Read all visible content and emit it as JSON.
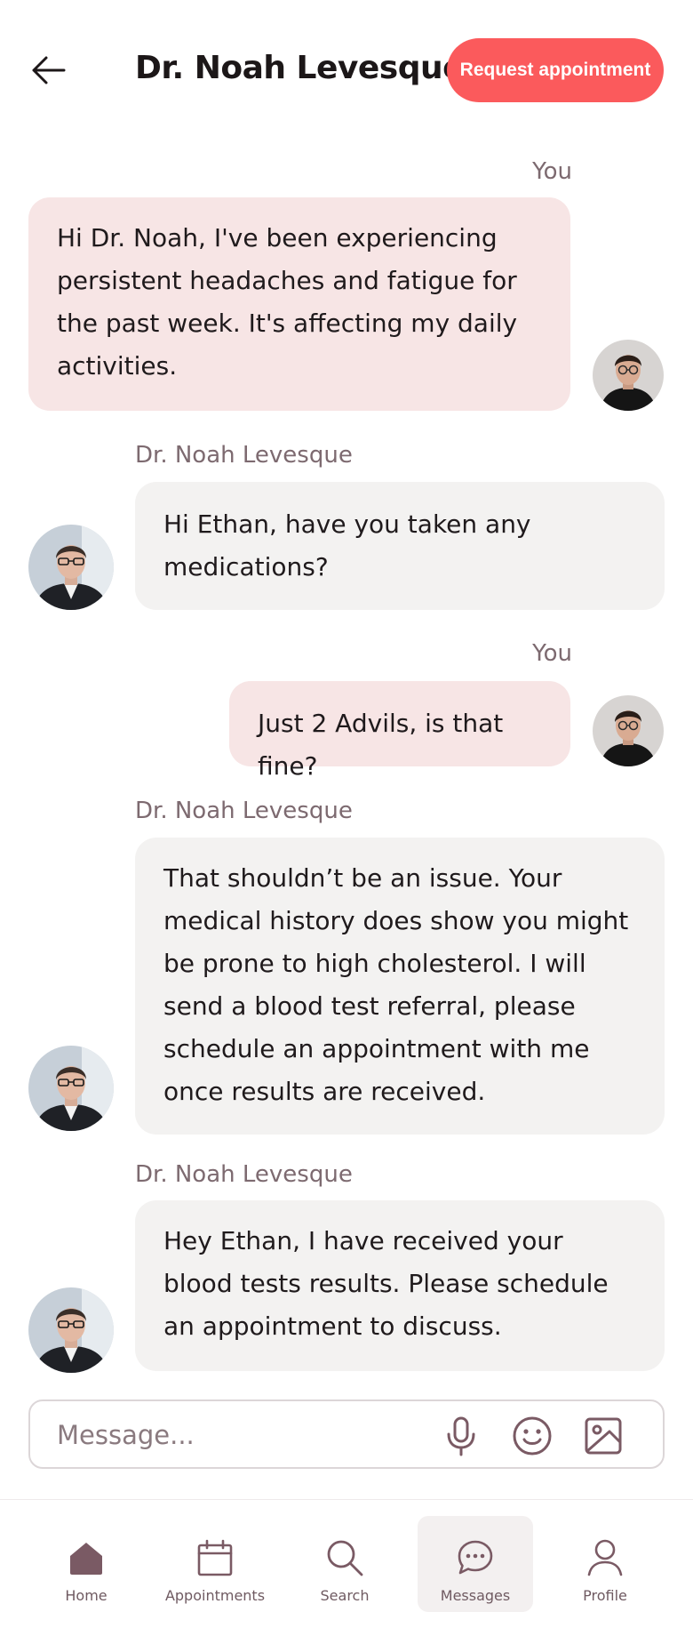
{
  "header": {
    "title": "Dr. Noah Levesque",
    "request_button": "Request appointment"
  },
  "messages": [
    {
      "sender": "You",
      "text": "Hi Dr. Noah, I've been experiencing persistent headaches and fatigue for the past week. It's affecting my daily activities."
    },
    {
      "sender": "Dr. Noah Levesque",
      "text": "Hi Ethan, have you taken any medications?"
    },
    {
      "sender": "You",
      "text": "Just 2 Advils, is that fine?"
    },
    {
      "sender": "Dr. Noah Levesque",
      "text": "That shouldn’t be an issue. Your medical history does show you might be prone to high cholesterol. I will send a blood test referral, please schedule an appointment with me once results are received."
    },
    {
      "sender": "Dr. Noah Levesque",
      "text": "Hey Ethan, I have received your blood tests results. Please schedule an appointment to discuss."
    }
  ],
  "composer": {
    "placeholder": "Message..."
  },
  "nav": {
    "items": [
      {
        "label": "Home",
        "icon": "home-icon"
      },
      {
        "label": "Appointments",
        "icon": "calendar-icon"
      },
      {
        "label": "Search",
        "icon": "search-icon"
      },
      {
        "label": "Messages",
        "icon": "chat-icon",
        "active": true
      },
      {
        "label": "Profile",
        "icon": "person-icon"
      }
    ]
  },
  "colors": {
    "accent": "#fb5a5c",
    "my_bubble": "#f7e5e5",
    "their_bubble": "#f3f2f1",
    "nav_icon": "#7a5a64"
  }
}
